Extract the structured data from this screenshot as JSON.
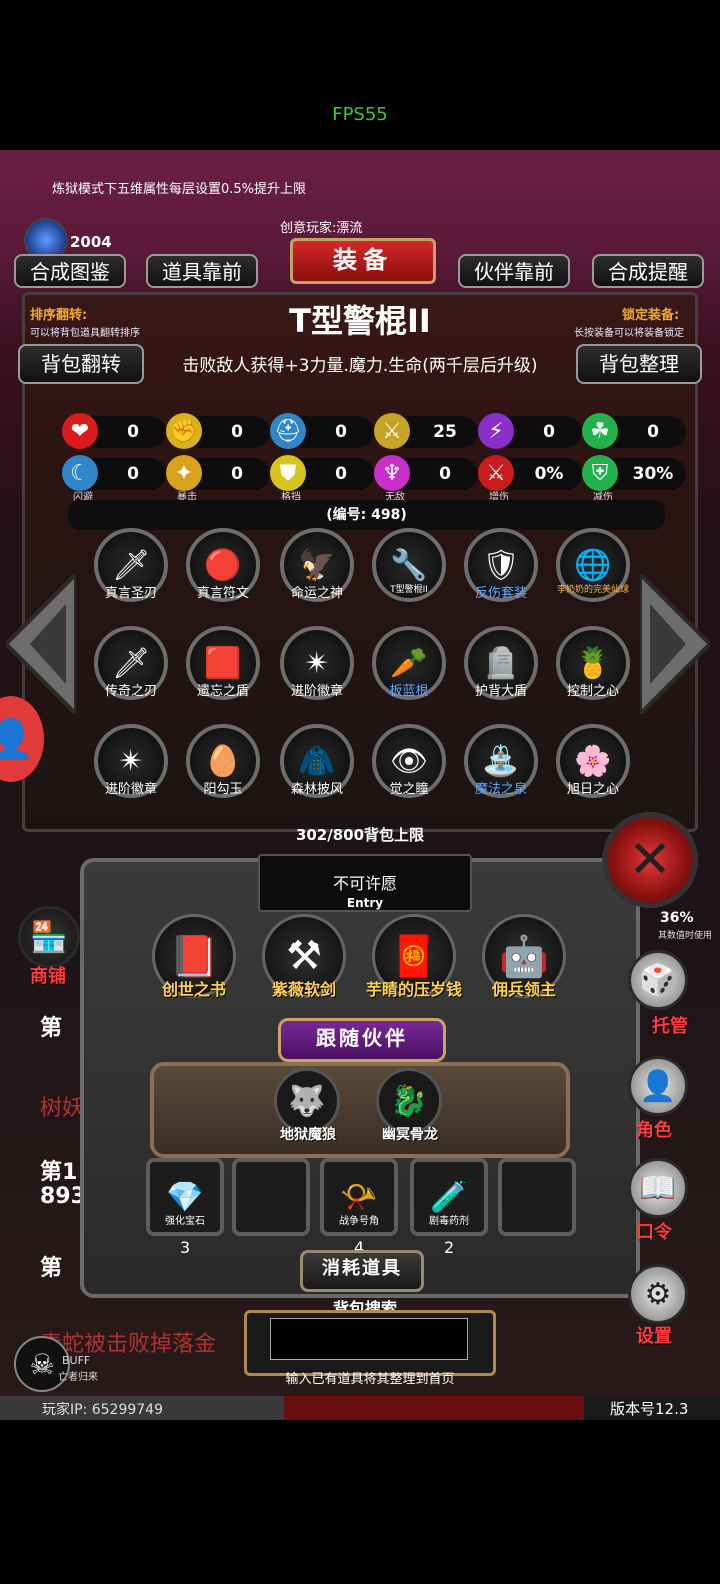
{
  "status": {
    "fps": "FPS55"
  },
  "banner": {
    "text": "炼狱模式下五维属性每层设置0.5%提升上限"
  },
  "currency": {
    "value": "2004"
  },
  "header": {
    "creative_player": "创意玩家:漂流",
    "title": "装备",
    "tabs": [
      "合成图鉴",
      "道具靠前",
      "伙伴靠前",
      "合成提醒"
    ]
  },
  "item": {
    "name": "T型警棍II",
    "description": "击败敌人获得+3力量.魔力.生命(两千层后升级)",
    "id_label": "(编号: 498)"
  },
  "left_controls": {
    "sort_label": "排序翻转:",
    "sort_hint": "可以将背包道具翻转排序",
    "flip_button": "背包翻转"
  },
  "right_controls": {
    "lock_label": "锁定装备:",
    "lock_hint": "长按装备可以将装备锁定",
    "organize_button": "背包整理"
  },
  "stats_row1": [
    {
      "icon": "heart-icon",
      "glyph": "❤",
      "color": "#d91c1c",
      "value": "0"
    },
    {
      "icon": "muscle-icon",
      "glyph": "✊",
      "color": "#d7b21c",
      "value": "0"
    },
    {
      "icon": "helmet-icon",
      "glyph": "⛑",
      "color": "#2f86c9",
      "value": "0"
    },
    {
      "icon": "sword-icon",
      "glyph": "⚔",
      "color": "#c9a326",
      "value": "25"
    },
    {
      "icon": "lightning-icon",
      "glyph": "⚡",
      "color": "#8a2fc9",
      "value": "0"
    },
    {
      "icon": "clover-icon",
      "glyph": "☘",
      "color": "#22b24c",
      "value": "0"
    }
  ],
  "stats_row2": [
    {
      "icon": "dodge-icon",
      "glyph": "☾",
      "color": "#2f86c9",
      "value": "0",
      "label": "闪避"
    },
    {
      "icon": "critical-icon",
      "glyph": "✦",
      "color": "#d7a21c",
      "value": "0",
      "label": "暴击"
    },
    {
      "icon": "block-icon",
      "glyph": "⛊",
      "color": "#d7c41c",
      "value": "0",
      "label": "格挡"
    },
    {
      "icon": "invincible-icon",
      "glyph": "♆",
      "color": "#c92fc9",
      "value": "0",
      "label": "无敌"
    },
    {
      "icon": "damage-boost-icon",
      "glyph": "⚔",
      "color": "#c91c1c",
      "value": "0%",
      "label": "增伤"
    },
    {
      "icon": "damage-reduce-icon",
      "glyph": "⛨",
      "color": "#22b24c",
      "value": "30%",
      "label": "减伤"
    }
  ],
  "bag_items": [
    {
      "name": "真言圣刃",
      "glyph": "🗡",
      "label_color": "#ffffff"
    },
    {
      "name": "真言符文",
      "glyph": "🔴",
      "label_color": "#ffffff"
    },
    {
      "name": "命运之神",
      "glyph": "🦅",
      "label_color": "#ffffff"
    },
    {
      "name": "T型警棍II",
      "glyph": "🔧",
      "label_color": "#ffffff"
    },
    {
      "name": "反伤套装",
      "glyph": "🛡",
      "label_color": "#6aa6ff"
    },
    {
      "name": "李奶奶的完美仙球",
      "glyph": "🌐",
      "label_color": "#ffb14a"
    },
    {
      "name": "传奇之刃",
      "glyph": "🗡",
      "label_color": "#ffffff"
    },
    {
      "name": "遗忘之盾",
      "glyph": "🟥",
      "label_color": "#ffffff"
    },
    {
      "name": "进阶徽章",
      "glyph": "✴",
      "label_color": "#ffffff"
    },
    {
      "name": "板蓝根",
      "glyph": "🥕",
      "label_color": "#6aa6ff"
    },
    {
      "name": "护背大盾",
      "glyph": "🪦",
      "label_color": "#ffffff"
    },
    {
      "name": "控制之心",
      "glyph": "🍍",
      "label_color": "#ffffff"
    },
    {
      "name": "进阶徽章",
      "glyph": "✴",
      "label_color": "#ffffff"
    },
    {
      "name": "阳勾玉",
      "glyph": "🥚",
      "label_color": "#ffffff"
    },
    {
      "name": "森林披风",
      "glyph": "🧥",
      "label_color": "#ffffff"
    },
    {
      "name": "觉之瞳",
      "glyph": "👁",
      "label_color": "#ffffff"
    },
    {
      "name": "魔法之泉",
      "glyph": "⛲",
      "label_color": "#6aa6ff"
    },
    {
      "name": "旭日之心",
      "glyph": "🌸",
      "label_color": "#ffffff"
    }
  ],
  "bag_limit": "302/800背包上限",
  "wish": {
    "title": "不可许愿",
    "sub": "Entry"
  },
  "equipped": [
    {
      "name": "创世之书",
      "glyph": "📕"
    },
    {
      "name": "紫薇软剑",
      "glyph": "⚒"
    },
    {
      "name": "芋睛的压岁钱",
      "glyph": "🧧"
    },
    {
      "name": "佣兵领主",
      "glyph": "🤖"
    }
  ],
  "companions_title": "跟随伙伴",
  "companions": [
    {
      "name": "地狱魔狼",
      "glyph": "🐺"
    },
    {
      "name": "幽冥骨龙",
      "glyph": "🐉"
    }
  ],
  "consumables": [
    {
      "name": "强化宝石",
      "glyph": "💎",
      "count": "3"
    },
    {
      "name": "",
      "glyph": "",
      "count": ""
    },
    {
      "name": "战争号角",
      "glyph": "📯",
      "count": "4"
    },
    {
      "name": "剧毒药剂",
      "glyph": "🧪",
      "count": "2"
    },
    {
      "name": "",
      "glyph": "",
      "count": ""
    }
  ],
  "consumables_title": "消耗道具",
  "search": {
    "title": "背包搜索",
    "value": "",
    "hint": "输入已有道具将其整理到首页"
  },
  "background_log": {
    "line1": "第",
    "line2": "树妖",
    "line3": "第1",
    "line4": "893",
    "line5": "第",
    "line6": "毒蛇被击败掉落金"
  },
  "sidebar_left": {
    "shop_label": "商铺"
  },
  "sidebar_right": {
    "hint": "其数值时使用",
    "value": "36%",
    "manage_label": "托管",
    "role_label": "角色",
    "code_label": "口令",
    "settings_label": "设置"
  },
  "buff": {
    "label": "BUFF",
    "sub": "亡者归来"
  },
  "footer": {
    "player_ip": "玩家IP: 65299749",
    "version": "版本号12.3"
  },
  "colors": {
    "accent_red": "#d62828",
    "gold": "#c9a463",
    "blue_label": "#6aa6ff"
  }
}
